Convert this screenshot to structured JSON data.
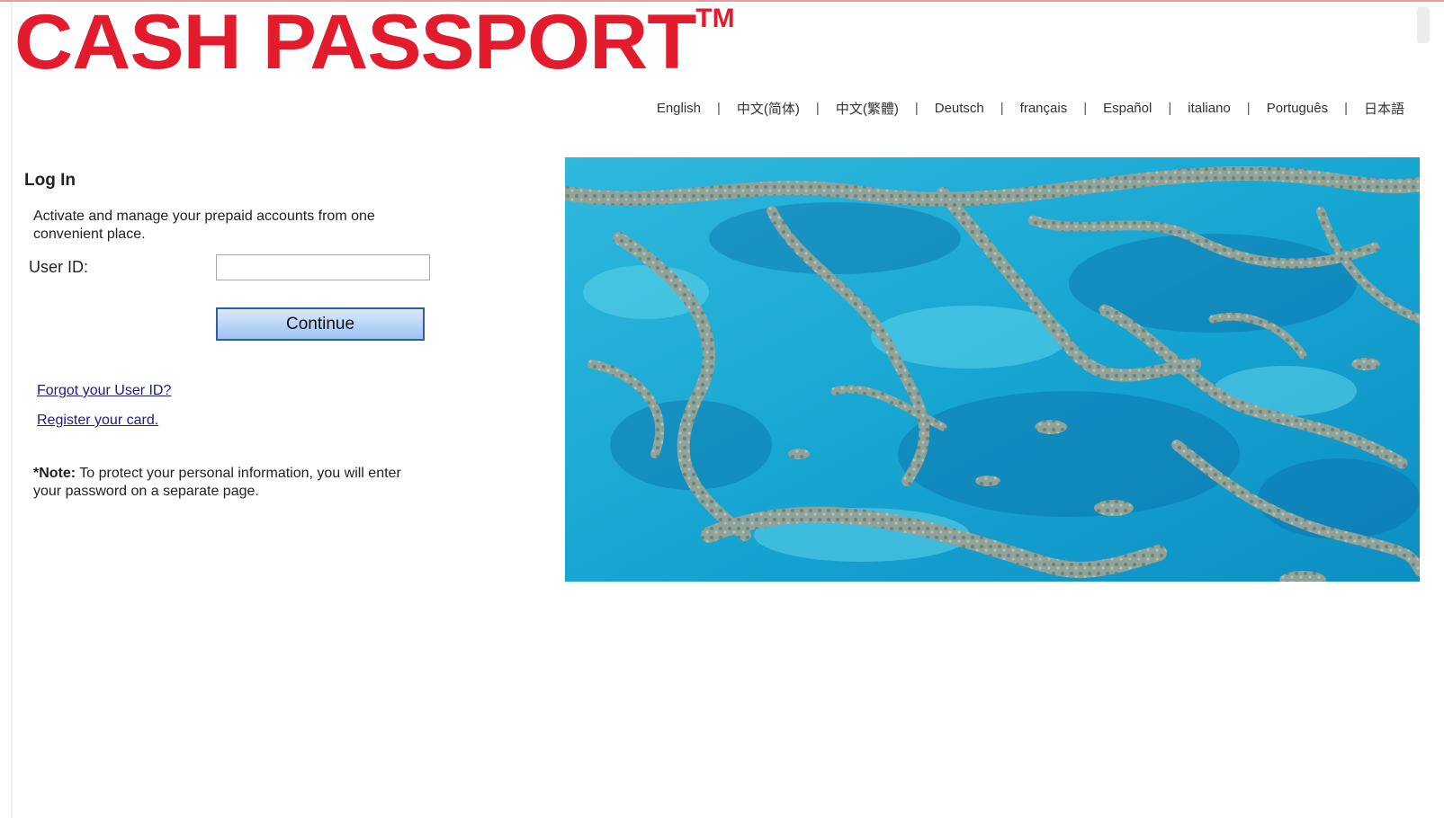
{
  "brand": {
    "logo_text": "CASH PASSPORT",
    "trademark": "TM",
    "color": "#e21b2d"
  },
  "languages": [
    {
      "label": "English"
    },
    {
      "label": "中文(简体)"
    },
    {
      "label": "中文(繁體)"
    },
    {
      "label": "Deutsch"
    },
    {
      "label": "français"
    },
    {
      "label": "Español"
    },
    {
      "label": "italiano"
    },
    {
      "label": "Português"
    },
    {
      "label": "日本語"
    }
  ],
  "language_separator": "|",
  "login": {
    "title": "Log In",
    "intro": "Activate and manage your prepaid accounts from one convenient place.",
    "user_id_label": "User ID:",
    "user_id_value": "",
    "continue_label": "Continue",
    "forgot_link": "Forgot your User ID?",
    "register_link": "Register your card.",
    "note_prefix": "*Note:",
    "note_text": " To protect your personal information, you will enter your password on a separate page."
  },
  "hero": {
    "subject": "aerial-reef-photo"
  }
}
